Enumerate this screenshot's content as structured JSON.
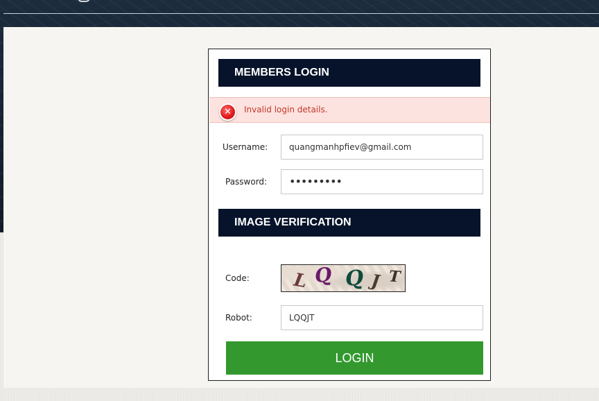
{
  "login_box": {
    "members_title": "MEMBERS LOGIN",
    "error_icon": "error-x-icon",
    "error_message": "Invalid login details.",
    "username_label": "Username:",
    "username_value": "quangmanhpfiev@gmail.com",
    "password_label": "Password:",
    "password_value": "•••••••••",
    "image_title": "IMAGE VERIFICATION",
    "code_label": "Code:",
    "captcha_chars": [
      "L",
      "Q",
      "Q",
      "J",
      "T"
    ],
    "robot_label": "Robot:",
    "robot_value": "LQQJT",
    "login_button": "LOGIN"
  },
  "colors": {
    "header_bg": "#06132a",
    "error_bg": "#fde3df",
    "error_text": "#c0392b",
    "button_bg": "#33992f"
  }
}
